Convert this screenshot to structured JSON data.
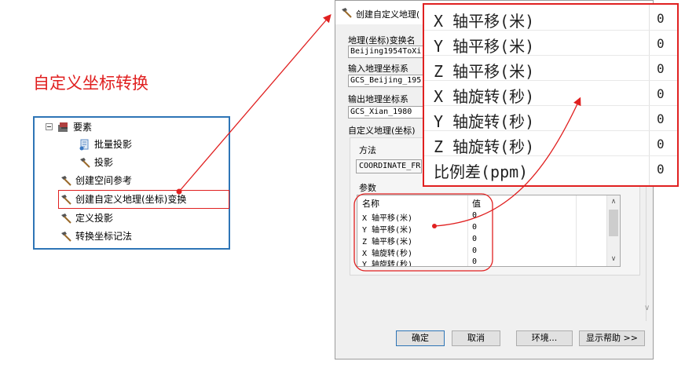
{
  "heading": "自定义坐标转换",
  "tree": {
    "items": [
      {
        "label": "要素",
        "icon": "toolbox-icon"
      },
      {
        "label": "批量投影",
        "icon": "script-icon"
      },
      {
        "label": "投影",
        "icon": "hammer-icon"
      },
      {
        "label": "创建空间参考",
        "icon": "hammer-icon"
      },
      {
        "label": "创建自定义地理(坐标)变换",
        "icon": "hammer-icon"
      },
      {
        "label": "定义投影",
        "icon": "hammer-icon"
      },
      {
        "label": "转换坐标记法",
        "icon": "hammer-icon"
      }
    ]
  },
  "dialog": {
    "title": "创建自定义地理(",
    "transform_name_label": "地理(坐标)变换名",
    "transform_name_value": "Beijing1954ToXi",
    "input_gcs_label": "输入地理坐标系",
    "input_gcs_value": "GCS_Beijing_195",
    "output_gcs_label": "输出地理坐标系",
    "output_gcs_value": "GCS_Xian_1980",
    "custom_transform_label": "自定义地理(坐标)",
    "method_label": "方法",
    "method_value": "COORDINATE_FR",
    "params_label": "参数",
    "params_header_name": "名称",
    "params_header_value": "值",
    "params": [
      {
        "name": "X 轴平移(米)",
        "value": "0"
      },
      {
        "name": "Y 轴平移(米)",
        "value": "0"
      },
      {
        "name": "Z 轴平移(米)",
        "value": "0"
      },
      {
        "name": "X 轴旋转(秒)",
        "value": "0"
      },
      {
        "name": "Y 轴旋转(秒)",
        "value": "0"
      }
    ],
    "buttons": {
      "ok": "确定",
      "cancel": "取消",
      "env": "环境...",
      "help": "显示帮助 >>"
    }
  },
  "zoom": {
    "rows": [
      {
        "name": "X 轴平移(米)",
        "value": "0"
      },
      {
        "name": "Y 轴平移(米)",
        "value": "0"
      },
      {
        "name": "Z 轴平移(米)",
        "value": "0"
      },
      {
        "name": "X 轴旋转(秒)",
        "value": "0"
      },
      {
        "name": "Y 轴旋转(秒)",
        "value": "0"
      },
      {
        "name": "Z 轴旋转(秒)",
        "value": "0"
      },
      {
        "name": "比例差(ppm)",
        "value": "0"
      }
    ]
  },
  "colors": {
    "annotation_red": "#e02020",
    "accent_blue": "#2e75b6"
  }
}
